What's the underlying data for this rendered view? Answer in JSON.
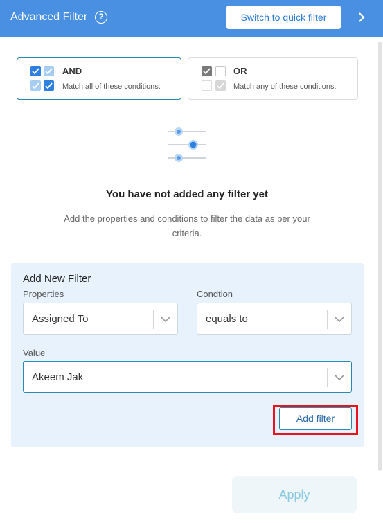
{
  "header": {
    "title": "Advanced Filter",
    "help_glyph": "?",
    "switch_label": "Switch to quick filter",
    "background": "#4a90e2"
  },
  "logic": {
    "and": {
      "label": "AND",
      "description": "Match all of these conditions:",
      "selected": true
    },
    "or": {
      "label": "OR",
      "description": "Match any of these conditions:",
      "selected": false
    }
  },
  "empty_state": {
    "title": "You have not added any filter yet",
    "description": "Add the properties and conditions to filter the data as per your criteria."
  },
  "add_filter": {
    "title": "Add New Filter",
    "properties": {
      "label": "Properties",
      "value": "Assigned To"
    },
    "condition": {
      "label": "Condtion",
      "value": "equals to"
    },
    "value": {
      "label": "Value",
      "value": "Akeem Jak"
    },
    "add_label": "Add filter"
  },
  "footer": {
    "apply_label": "Apply"
  },
  "colors": {
    "accent": "#2a8ab0",
    "highlight": "#e8141d",
    "panel": "#e8f2fd"
  }
}
